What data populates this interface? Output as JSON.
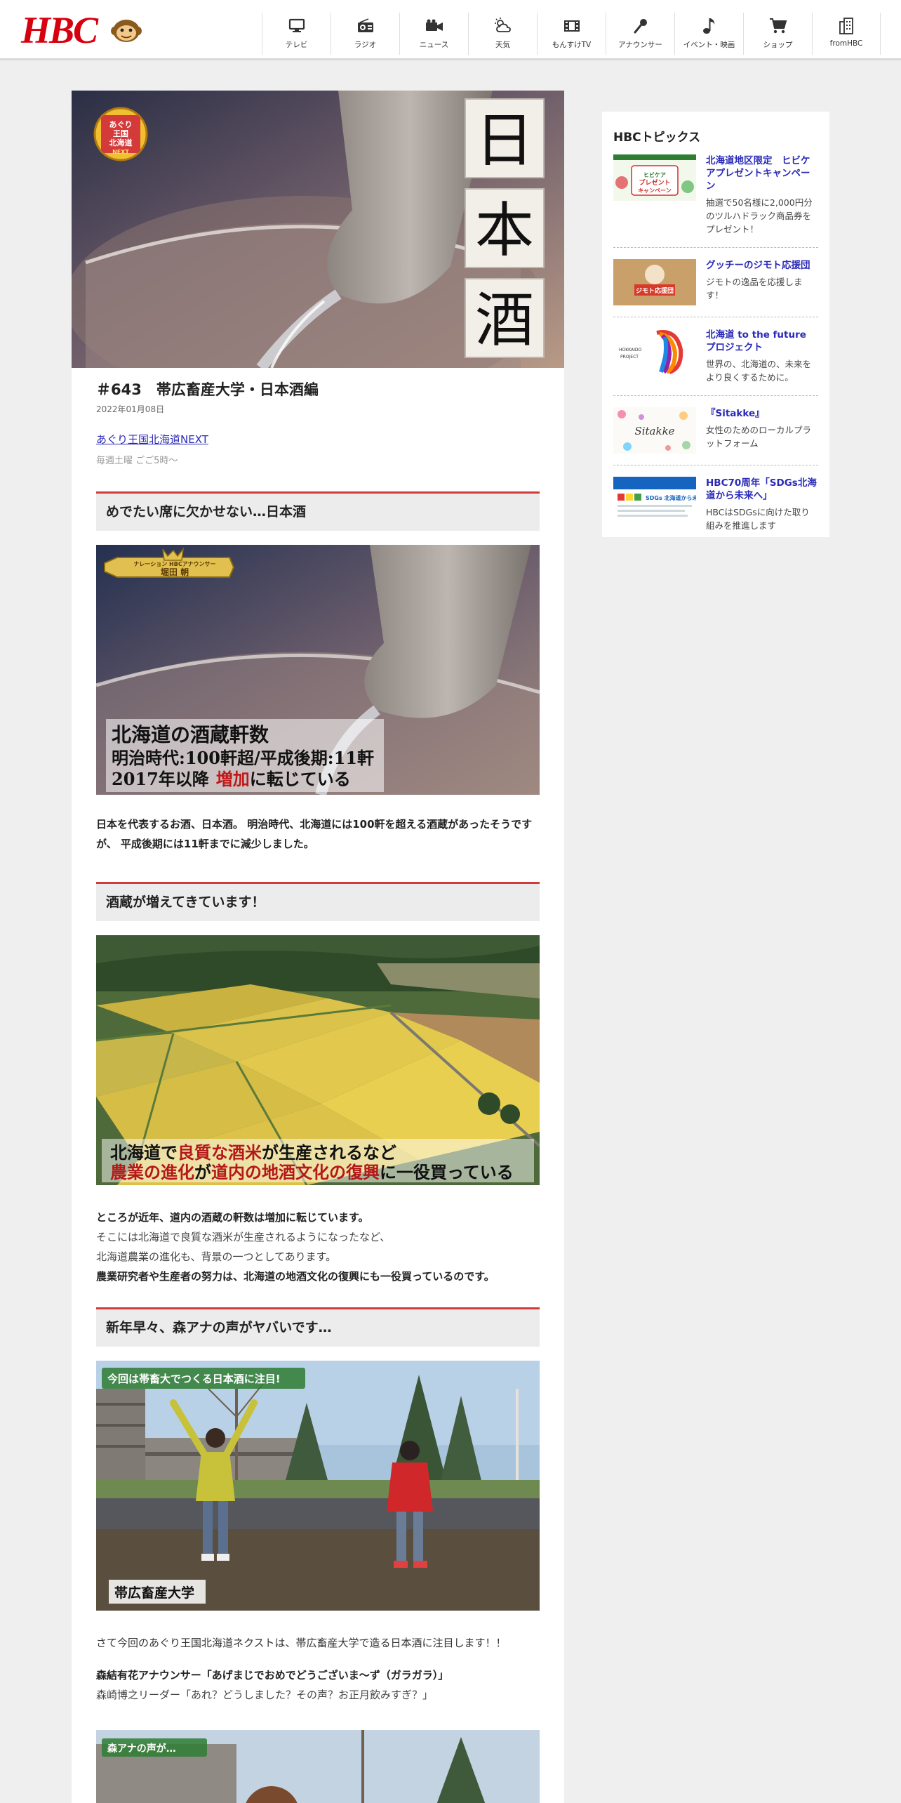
{
  "header": {
    "logo_text": "HBC",
    "nav": [
      {
        "label": "テレビ",
        "icon": "tv-icon"
      },
      {
        "label": "ラジオ",
        "icon": "radio-icon"
      },
      {
        "label": "ニュース",
        "icon": "video-camera-icon"
      },
      {
        "label": "天気",
        "icon": "weather-icon"
      },
      {
        "label": "もんすけTV",
        "icon": "film-icon"
      },
      {
        "label": "アナウンサー",
        "icon": "microphone-icon"
      },
      {
        "label": "イベント・映画",
        "icon": "music-note-icon"
      },
      {
        "label": "ショップ",
        "icon": "cart-icon"
      },
      {
        "label": "fromHBC",
        "icon": "building-icon"
      }
    ]
  },
  "article": {
    "hero_kanji": [
      "日",
      "本",
      "酒"
    ],
    "hero_badge": [
      "あぐり",
      "王国",
      "北海道",
      "NEXT"
    ],
    "title": "＃643　帯広畜産大学・日本酒編",
    "date": "2022年01月08日",
    "program_link": "あぐり王国北海道NEXT",
    "schedule": "毎週土曜 ごご5時～",
    "sections": [
      {
        "heading": "めでたい席に欠かせない…日本酒",
        "image": {
          "badge_small": "ナレーション HBCアナウンサー",
          "badge_name": "堀田 朝",
          "caption": [
            "北海道の酒蔵軒数",
            "明治時代:100軒超/平成後期:11軒"
          ],
          "caption_line3_pre": "2017年以降",
          "caption_line3_em": "増加",
          "caption_line3_post": "に転じている"
        },
        "text": "日本を代表するお酒、日本酒。 明治時代、北海道には100軒を超える酒蔵があったそうですが、 平成後期には11軒までに減少しました。"
      },
      {
        "heading": "酒蔵が増えてきています！",
        "image": {
          "line1_a": "北海道で",
          "line1_b": "良質な酒米",
          "line1_c": "が生産されるなど",
          "line2_a": "農業の進化",
          "line2_b": "が",
          "line2_c": "道内の地酒文化の復興",
          "line2_d": "に一役買っている"
        },
        "text_bold1": "ところが近年、道内の酒蔵の軒数は増加に転じています。",
        "text_normal1": "そこには北海道で良質な酒米が生産されるようになったなど、",
        "text_normal2": "北海道農業の進化も、背景の一つとしてあります。",
        "text_bold2": "農業研究者や生産者の努力は、北海道の地酒文化の復興にも一役買っているのです。"
      },
      {
        "heading": "新年早々、森アナの声がヤバいです…",
        "image": {
          "top_caption": "今回は帯畜大でつくる日本酒に注目!",
          "bottom_caption": "帯広畜産大学"
        },
        "text_intro": "さて今回のあぐり王国北海道ネクストは、帯広畜産大学で造る日本酒に注目します！！",
        "quote_bold": "森結有花アナウンサー「あげまじでおめでどうございま～ず（ガラガラ）」",
        "quote_normal": "森崎博之リーダー「あれ？どうしました？その声？お正月飲みすぎ？」"
      }
    ],
    "partial_image_caption": "森アナの声が…"
  },
  "sidebar": {
    "title": "HBCトピックス",
    "topics": [
      {
        "title": "北海道地区限定　ヒビケアプレゼントキャンペーン",
        "desc": "抽選で50名様に2,000円分のツルハドラック商品券をプレゼント！",
        "thumb_text": "ヒビケア プレゼント キャンペーン"
      },
      {
        "title": "グッチーのジモト応援団",
        "desc": "ジモトの逸品を応援します！",
        "thumb_text": "ジモト応援団"
      },
      {
        "title": "北海道 to the future プロジェクト",
        "desc": "世界の、北海道の、未来をより良くするために。",
        "thumb_text": "HOKKAIDO PROJECT"
      },
      {
        "title": "『Sitakke』",
        "desc": "女性のためのローカルプラットフォーム",
        "thumb_text": "Sitakke"
      },
      {
        "title": "HBC70周年「SDGs北海道から未来へ」",
        "desc": "HBCはSDGsに向けた取り組みを推進します",
        "thumb_text": "SDGs 北海道から未来へ"
      }
    ]
  }
}
